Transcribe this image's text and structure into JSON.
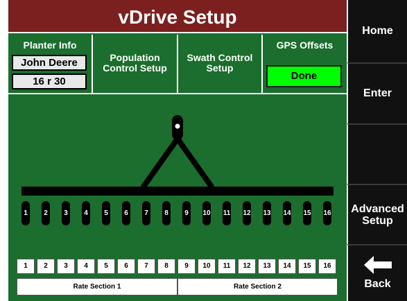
{
  "title": "vDrive Setup",
  "planter_info": {
    "heading": "Planter Info",
    "make": "John Deere",
    "size": "16 r 30"
  },
  "population": {
    "label": "Population Control Setup"
  },
  "swath": {
    "label": "Swath Control Setup"
  },
  "gps": {
    "label": "GPS Offsets",
    "done_label": "Done"
  },
  "row_units": [
    "1",
    "2",
    "3",
    "4",
    "5",
    "6",
    "7",
    "8",
    "9",
    "10",
    "11",
    "12",
    "13",
    "14",
    "15",
    "16"
  ],
  "row_buttons": [
    "1",
    "2",
    "3",
    "4",
    "5",
    "6",
    "7",
    "8",
    "9",
    "10",
    "11",
    "12",
    "13",
    "14",
    "15",
    "16"
  ],
  "rate_sections": [
    "Rate Section 1",
    "Rate Section 2"
  ],
  "sidebar": {
    "home": "Home",
    "enter": "Enter",
    "advanced": "Advanced Setup",
    "back": "Back"
  },
  "colors": {
    "title_bar": "#7c1f1f",
    "panel_green": "#1b6e2d",
    "done_green": "#00ff00",
    "sidebar": "#111111"
  }
}
